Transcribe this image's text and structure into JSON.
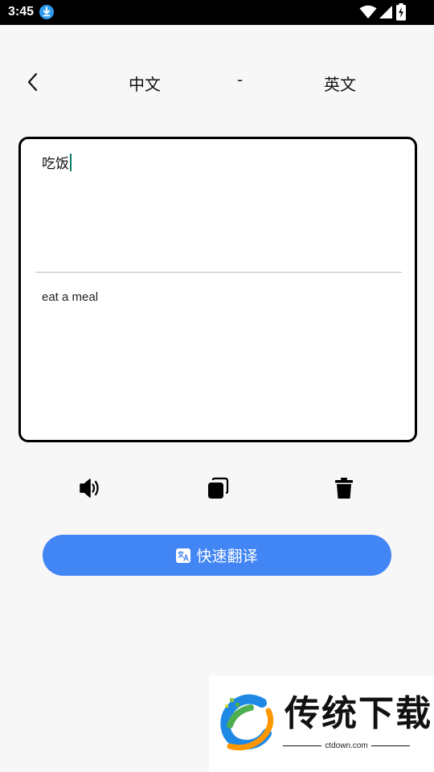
{
  "status_bar": {
    "time": "3:45",
    "icons": [
      "download-icon",
      "wifi-icon",
      "cellular-icon",
      "battery-charging-icon"
    ]
  },
  "header": {
    "back_icon": "chevron-left-icon",
    "source_lang": "中文",
    "separator": "-",
    "target_lang": "英文"
  },
  "editor": {
    "input_value": "吃饭",
    "result_value": "eat a meal"
  },
  "actions": [
    {
      "icon": "speaker-icon"
    },
    {
      "icon": "copy-icon"
    },
    {
      "icon": "trash-icon"
    }
  ],
  "translate_button": {
    "icon": "translate-icon",
    "label": "快速翻译"
  },
  "watermark": {
    "title": "传统下载",
    "site": "ctdown.com"
  },
  "colors": {
    "accent": "#4285f4",
    "caret": "#0a7d6b",
    "background": "#f7f7f7",
    "status_bar": "#000000"
  }
}
